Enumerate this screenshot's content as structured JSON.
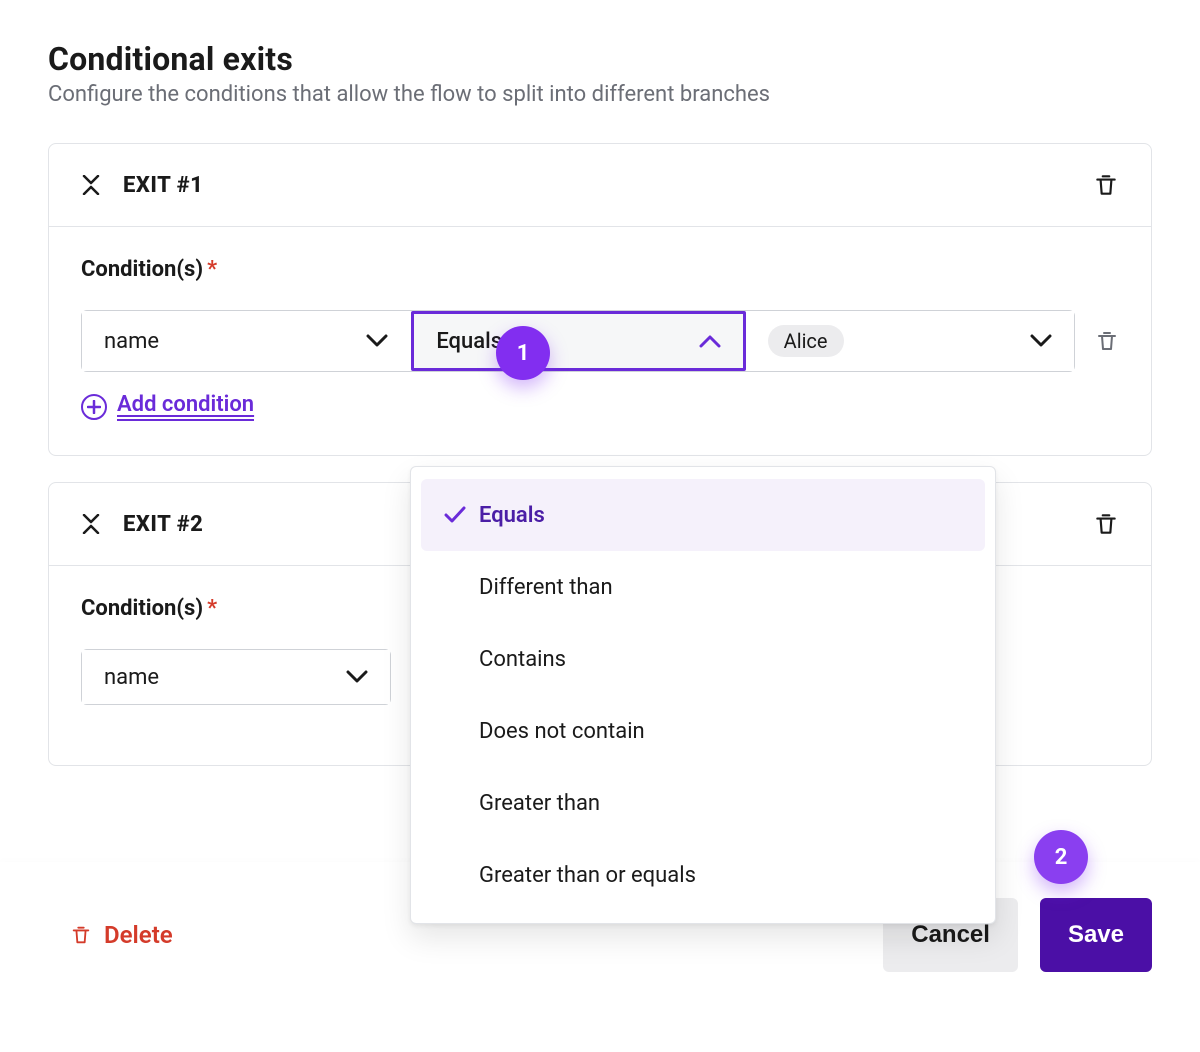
{
  "header": {
    "title": "Conditional exits",
    "subtitle": "Configure the conditions that allow the flow to split into different branches"
  },
  "exits": [
    {
      "title": "EXIT #1",
      "conditions_label": "Condition(s)",
      "row": {
        "field": "name",
        "operator": "Equals",
        "value": "Alice"
      },
      "add_label": "Add condition"
    },
    {
      "title": "EXIT #2",
      "conditions_label": "Condition(s)",
      "row": {
        "field": "name"
      }
    }
  ],
  "operator_options": [
    "Equals",
    "Different than",
    "Contains",
    "Does not contain",
    "Greater than",
    "Greater than or equals"
  ],
  "operator_selected_index": 0,
  "callouts": {
    "one": "1",
    "two": "2"
  },
  "footer": {
    "delete": "Delete",
    "cancel": "Cancel",
    "save": "Save"
  }
}
